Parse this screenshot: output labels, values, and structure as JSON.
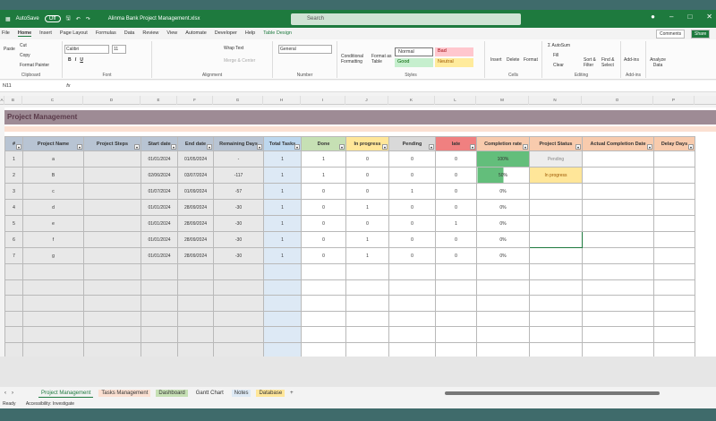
{
  "titlebar": {
    "autosave": "AutoSave",
    "toggle": "Off",
    "filename": "Alinma Bank Project Management.xlsx",
    "search": "Search"
  },
  "menu": [
    "File",
    "Home",
    "Insert",
    "Page Layout",
    "Formulas",
    "Data",
    "Review",
    "View",
    "Automate",
    "Developer",
    "Help",
    "Table Design"
  ],
  "top_buttons": {
    "comments": "Comments",
    "share": "Share"
  },
  "ribbon": {
    "clipboard": {
      "label": "Clipboard",
      "paste": "Paste",
      "cut": "Cut",
      "copy": "Copy",
      "format_painter": "Format Painter"
    },
    "font": {
      "label": "Font",
      "name": "Calibri",
      "size": "11"
    },
    "alignment": {
      "label": "Alignment",
      "wrap": "Wrap Text",
      "merge": "Merge & Center"
    },
    "number": {
      "label": "Number",
      "format": "General"
    },
    "styles": {
      "label": "Styles",
      "conditional": "Conditional Formatting",
      "format_table": "Format as Table",
      "normal": "Normal",
      "bad": "Bad",
      "good": "Good",
      "neutral": "Neutral"
    },
    "cells": {
      "label": "Cells",
      "insert": "Insert",
      "delete": "Delete",
      "format": "Format"
    },
    "editing": {
      "label": "Editing",
      "autosum": "AutoSum",
      "fill": "Fill",
      "clear": "Clear",
      "sort": "Sort & Filter",
      "find": "Find & Select"
    },
    "addins": {
      "label": "Add-ins",
      "addins": "Add-ins",
      "analyze": "Analyze Data"
    }
  },
  "formula_bar": {
    "cell_ref": "N11",
    "fx": "fx"
  },
  "columns": [
    "A",
    "B",
    "C",
    "D",
    "E",
    "F",
    "G",
    "H",
    "I",
    "J",
    "K",
    "L",
    "M",
    "N",
    "O",
    "P"
  ],
  "sheet": {
    "title": "Project Management",
    "headers": [
      "#",
      "Project Name",
      "Project Steps",
      "Start date",
      "End date",
      "Remaining Days",
      "Total Tasks",
      "Done",
      "In progress",
      "Pending",
      "late",
      "Completion rate",
      "Project Status",
      "Actual Completion Date",
      "Delay Days"
    ],
    "rows": [
      [
        "1",
        "a",
        "",
        "01/01/2024",
        "01/05/2024",
        "-",
        "1",
        "1",
        "0",
        "0",
        "0",
        "100%",
        "Pending",
        "",
        ""
      ],
      [
        "2",
        "B",
        "",
        "02/06/2024",
        "03/07/2024",
        "-117",
        "1",
        "1",
        "0",
        "0",
        "0",
        "50%",
        "In progress",
        "",
        ""
      ],
      [
        "3",
        "c",
        "",
        "01/07/2024",
        "01/09/2024",
        "-57",
        "1",
        "0",
        "0",
        "1",
        "0",
        "0%",
        "",
        "",
        ""
      ],
      [
        "4",
        "d",
        "",
        "01/01/2024",
        "28/09/2024",
        "-30",
        "1",
        "0",
        "1",
        "0",
        "0",
        "0%",
        "",
        "",
        ""
      ],
      [
        "5",
        "e",
        "",
        "01/01/2024",
        "28/09/2024",
        "-30",
        "1",
        "0",
        "0",
        "0",
        "1",
        "0%",
        "",
        "",
        ""
      ],
      [
        "6",
        "f",
        "",
        "01/01/2024",
        "28/09/2024",
        "-30",
        "1",
        "0",
        "1",
        "0",
        "0",
        "0%",
        "",
        "",
        ""
      ],
      [
        "7",
        "g",
        "",
        "01/01/2024",
        "28/09/2024",
        "-30",
        "1",
        "0",
        "1",
        "0",
        "0",
        "0%",
        "",
        "",
        ""
      ]
    ],
    "completion_fraction": [
      1,
      0.5,
      0,
      0,
      0,
      0,
      0
    ]
  },
  "sheet_tabs": [
    "Project Management",
    "Tasks Management",
    "Dashboard",
    "Gantt Chart",
    "Notes",
    "Database"
  ],
  "status": {
    "ready": "Ready",
    "accessibility": "Accessibility: Investigate"
  },
  "colors": {
    "green": "#1e7a3e",
    "teal": "#3f6b6b",
    "done": "#c6e0b4",
    "inprogress": "#ffe699",
    "pending": "#d9d9d9",
    "late": "#f08080",
    "orange": "#f8cbad"
  }
}
